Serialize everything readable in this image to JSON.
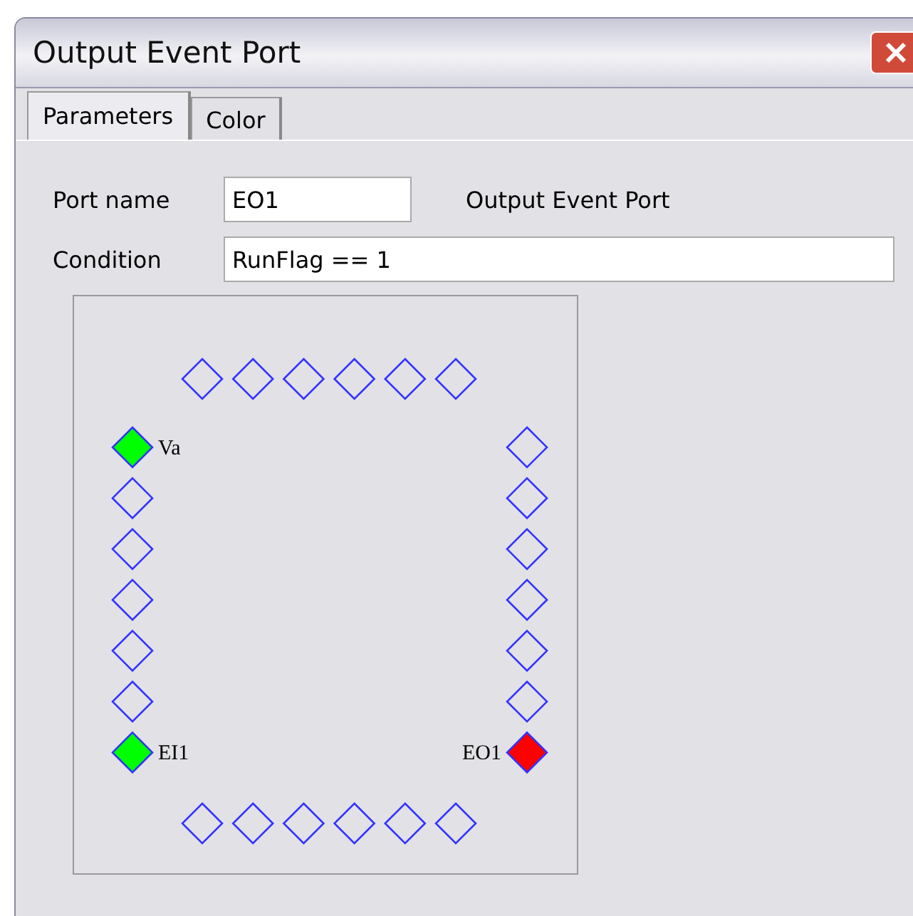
{
  "window": {
    "title": "Output Event Port"
  },
  "tabs": [
    {
      "label": "Parameters",
      "selected": true
    },
    {
      "label": "Color",
      "selected": false
    }
  ],
  "fields": [
    {
      "label": "Port name",
      "value": "EO1",
      "note": "Output Event Port",
      "kind": "short"
    },
    {
      "label": "Condition",
      "value": "RunFlag == 1",
      "kind": "long"
    }
  ],
  "ports": {
    "top": [
      {
        "filled": false
      },
      {
        "filled": false
      },
      {
        "filled": false
      },
      {
        "filled": false
      },
      {
        "filled": false
      },
      {
        "filled": false
      }
    ],
    "left": [
      {
        "filled": true,
        "color": "#00ff00",
        "label": "Va"
      },
      {
        "filled": false
      },
      {
        "filled": false
      },
      {
        "filled": false
      },
      {
        "filled": false
      },
      {
        "filled": false
      },
      {
        "filled": true,
        "color": "#00ff00",
        "label": "EI1"
      }
    ],
    "right": [
      {
        "filled": false
      },
      {
        "filled": false
      },
      {
        "filled": false
      },
      {
        "filled": false
      },
      {
        "filled": false
      },
      {
        "filled": false
      },
      {
        "filled": true,
        "color": "#ff0000",
        "label": "EO1"
      }
    ],
    "bottom": [
      {
        "filled": false
      },
      {
        "filled": false
      },
      {
        "filled": false
      },
      {
        "filled": false
      },
      {
        "filled": false
      },
      {
        "filled": false
      }
    ]
  }
}
